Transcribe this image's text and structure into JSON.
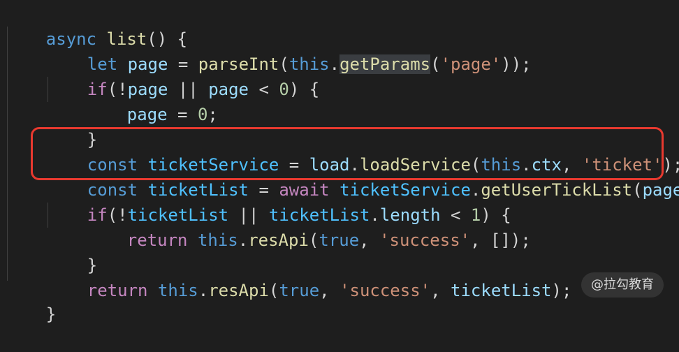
{
  "code": {
    "line1": {
      "t1": "async",
      "t2": " ",
      "t3": "list",
      "t4": "() {"
    },
    "line2": {
      "t1": "let",
      "t2": " ",
      "t3": "page",
      "t4": " = ",
      "t5": "parseInt",
      "t6": "(",
      "t7": "this",
      "t8": ".",
      "t9": "getParams",
      "t10": "(",
      "t11": "'page'",
      "t12": "));"
    },
    "line3": {
      "t1": "if",
      "t2": "(!",
      "t3": "page",
      "t4": " || ",
      "t5": "page",
      "t6": " < ",
      "t7": "0",
      "t8": ") {"
    },
    "line4": {
      "t1": "page",
      "t2": " = ",
      "t3": "0",
      "t4": ";"
    },
    "line5": {
      "t1": "}"
    },
    "line6": {
      "t1": "const",
      "t2": " ",
      "t3": "ticketService",
      "t4": " = ",
      "t5": "load",
      "t6": ".",
      "t7": "loadService",
      "t8": "(",
      "t9": "this",
      "t10": ".",
      "t11": "ctx",
      "t12": ", ",
      "t13": "'ticket'",
      "t14": ");"
    },
    "line7": {
      "t1": "const",
      "t2": " ",
      "t3": "ticketList",
      "t4": " = ",
      "t5": "await",
      "t6": " ",
      "t7": "ticketService",
      "t8": ".",
      "t9": "getUserTickList",
      "t10": "(",
      "t11": "page",
      "t12": ");"
    },
    "line8": {
      "t1": "if",
      "t2": "(!",
      "t3": "ticketList",
      "t4": " || ",
      "t5": "ticketList",
      "t6": ".",
      "t7": "length",
      "t8": " < ",
      "t9": "1",
      "t10": ") {"
    },
    "line9": {
      "t1": "return",
      "t2": " ",
      "t3": "this",
      "t4": ".",
      "t5": "resApi",
      "t6": "(",
      "t7": "true",
      "t8": ", ",
      "t9": "'success'",
      "t10": ", []);"
    },
    "line10": {
      "t1": "}"
    },
    "line11": {
      "t1": "return",
      "t2": " ",
      "t3": "this",
      "t4": ".",
      "t5": "resApi",
      "t6": "(",
      "t7": "true",
      "t8": ", ",
      "t9": "'success'",
      "t10": ", ",
      "t11": "ticketList",
      "t12": ");"
    },
    "line12": {
      "t1": "}"
    }
  },
  "watermark": "@拉勾教育",
  "colors": {
    "background": "#1e1e1e",
    "keyword": "#569cd6",
    "control": "#c586c0",
    "function": "#dcdcaa",
    "variable": "#9cdcfe",
    "constant": "#4fc1ff",
    "string": "#ce9178",
    "number": "#b5cea8",
    "highlight_box": "#e8392f"
  }
}
